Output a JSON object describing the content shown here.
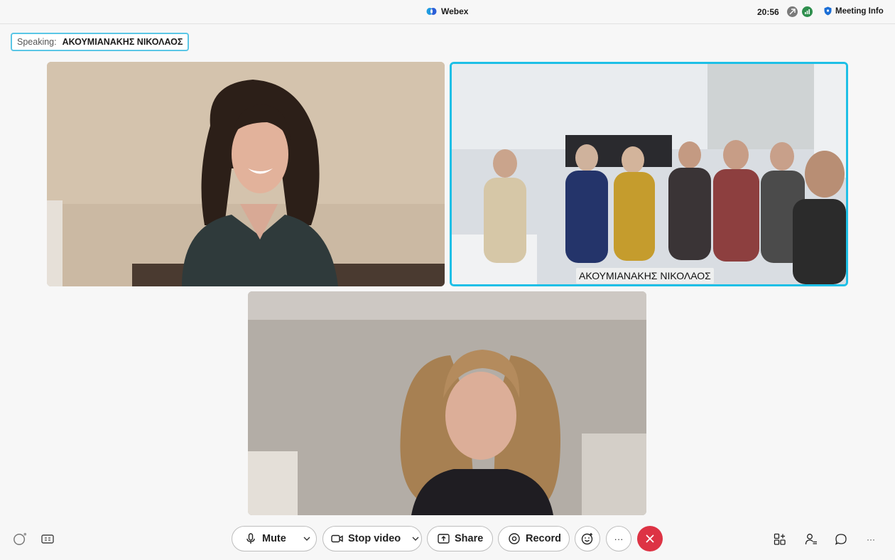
{
  "window": {
    "app_title": "Webex",
    "clock": "20:56",
    "meeting_info_label": "Meeting Info"
  },
  "speaking": {
    "prefix": "Speaking:",
    "name": "ΑΚΟΥΜΙΑΝΑΚΗΣ ΝΙΚΟΛΑΟΣ"
  },
  "tiles": [
    {
      "name": "participant-1",
      "label": ""
    },
    {
      "name": "participant-2",
      "label": "ΑΚΟΥΜΙΑΝΑΚΗΣ ΝΙΚΟΛΑΟΣ",
      "active": true
    },
    {
      "name": "participant-3",
      "label": ""
    }
  ],
  "toolbar": {
    "mute_label": "Mute",
    "stop_video_label": "Stop video",
    "share_label": "Share",
    "record_label": "Record",
    "more_glyph": "···",
    "right_more_glyph": "···"
  },
  "colors": {
    "accent": "#1ebfe6",
    "end_call": "#dd3344",
    "speaking_border": "#5ac6e6"
  },
  "icons": [
    "webex-logo-icon",
    "connection-icon",
    "signal-icon",
    "shield-icon",
    "status-ring-icon",
    "captions-icon",
    "microphone-icon",
    "chevron-down-icon",
    "camera-icon",
    "share-icon",
    "record-icon",
    "reactions-icon",
    "more-icon",
    "close-icon",
    "layout-icon",
    "participants-icon",
    "chat-icon"
  ]
}
